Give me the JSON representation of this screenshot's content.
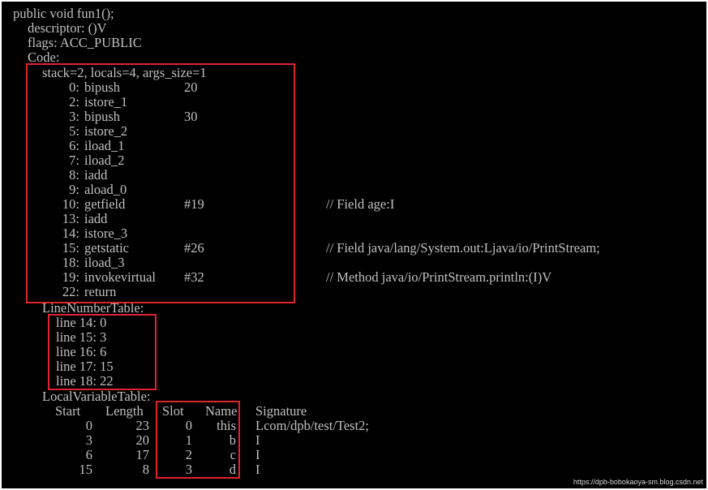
{
  "terminal": {
    "colors": {
      "background": "#000000",
      "text": "#c0c0c0",
      "highlight_box": "#e0242c"
    },
    "header": [
      "public void fun1();",
      "descriptor: ()V",
      "flags: ACC_PUBLIC",
      "Code:"
    ],
    "stack_info": "stack=2, locals=4, args_size=1",
    "instructions": [
      {
        "offset": "0:",
        "opcode": "bipush",
        "operand": "20",
        "comment": ""
      },
      {
        "offset": "2:",
        "opcode": "istore_1",
        "operand": "",
        "comment": ""
      },
      {
        "offset": "3:",
        "opcode": "bipush",
        "operand": "30",
        "comment": ""
      },
      {
        "offset": "5:",
        "opcode": "istore_2",
        "operand": "",
        "comment": ""
      },
      {
        "offset": "6:",
        "opcode": "iload_1",
        "operand": "",
        "comment": ""
      },
      {
        "offset": "7:",
        "opcode": "iload_2",
        "operand": "",
        "comment": ""
      },
      {
        "offset": "8:",
        "opcode": "iadd",
        "operand": "",
        "comment": ""
      },
      {
        "offset": "9:",
        "opcode": "aload_0",
        "operand": "",
        "comment": ""
      },
      {
        "offset": "10:",
        "opcode": "getfield",
        "operand": "#19",
        "comment": "// Field age:I"
      },
      {
        "offset": "13:",
        "opcode": "iadd",
        "operand": "",
        "comment": ""
      },
      {
        "offset": "14:",
        "opcode": "istore_3",
        "operand": "",
        "comment": ""
      },
      {
        "offset": "15:",
        "opcode": "getstatic",
        "operand": "#26",
        "comment": "// Field java/lang/System.out:Ljava/io/PrintStream;"
      },
      {
        "offset": "18:",
        "opcode": "iload_3",
        "operand": "",
        "comment": ""
      },
      {
        "offset": "19:",
        "opcode": "invokevirtual",
        "operand": "#32",
        "comment": "// Method java/io/PrintStream.println:(I)V"
      },
      {
        "offset": "22:",
        "opcode": "return",
        "operand": "",
        "comment": ""
      }
    ],
    "line_number_table": {
      "title": "LineNumberTable:",
      "entries": [
        "line 14: 0",
        "line 15: 3",
        "line 16: 6",
        "line 17: 15",
        "line 18: 22"
      ]
    },
    "local_variable_table": {
      "title": "LocalVariableTable:",
      "columns": {
        "start": "Start",
        "length": "Length",
        "slot": "Slot",
        "name": "Name",
        "signature": "Signature"
      },
      "rows": [
        {
          "start": "0",
          "length": "23",
          "slot": "0",
          "name": "this",
          "signature": "Lcom/dpb/test/Test2;"
        },
        {
          "start": "3",
          "length": "20",
          "slot": "1",
          "name": "b",
          "signature": "I"
        },
        {
          "start": "6",
          "length": "17",
          "slot": "2",
          "name": "c",
          "signature": "I"
        },
        {
          "start": "15",
          "length": "8",
          "slot": "3",
          "name": "d",
          "signature": "I"
        }
      ]
    }
  },
  "watermark": "https://dpb-bobokaoya-sm.blog.csdn.net"
}
